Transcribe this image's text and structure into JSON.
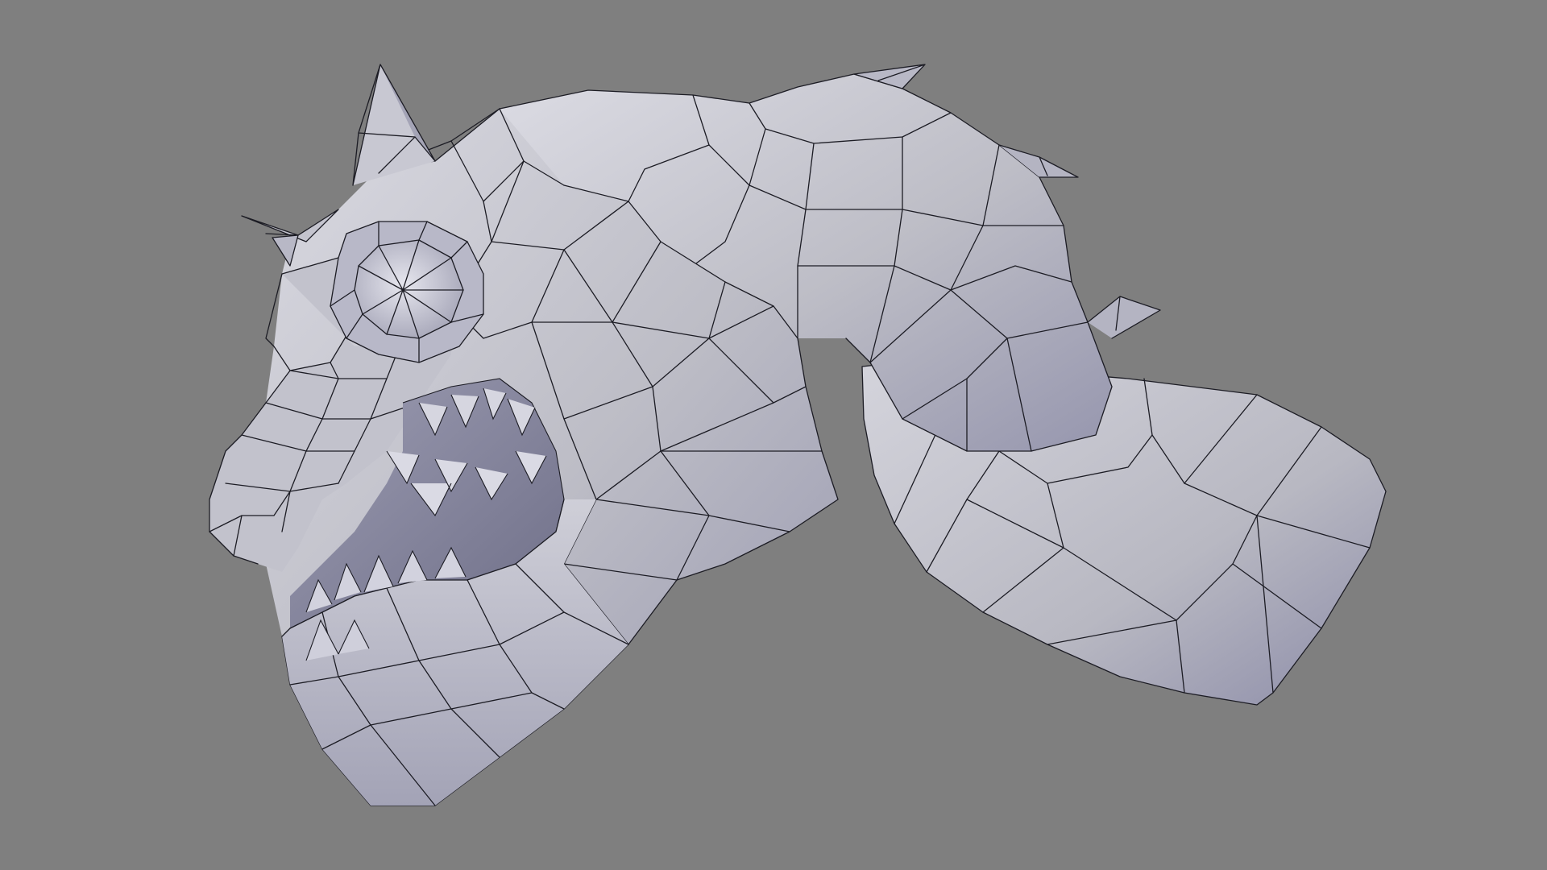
{
  "viewport": {
    "background_color": "#7f7f7f",
    "mesh_base_color": "#c4c4cc",
    "mesh_highlight_color": "#e4e4ec",
    "mesh_shadow_color": "#7c7c96",
    "wire_color": "#1c1c24",
    "shading": "solid-with-wireframe"
  },
  "model": {
    "subject": "low-poly-creature-head-and-tail-mesh",
    "parts": [
      "head",
      "horn",
      "ear-spikes",
      "eye",
      "open-jaw",
      "teeth",
      "neck",
      "back-spikes",
      "tail-segment"
    ]
  }
}
